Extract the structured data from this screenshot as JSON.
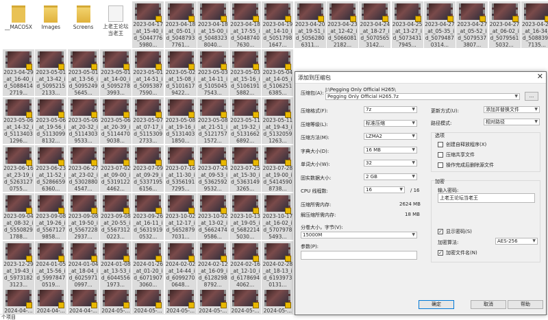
{
  "explorer": {
    "status": "个项目",
    "rows": [
      [
        {
          "label": "__MACOSX",
          "type": "folder"
        },
        {
          "label": "Images",
          "type": "folder-img"
        },
        {
          "label": "Screens",
          "type": "folder-img"
        },
        {
          "label": "上老王论坛当老王",
          "type": "file"
        },
        {
          "label": "2023-04-17_at_15-40_id_50447765980...",
          "type": "video"
        },
        {
          "label": "2023-04-18_at_05-01_id_50487937761...",
          "type": "video"
        },
        {
          "label": "2023-04-18_at_15-00_id_50483238040...",
          "type": "video"
        },
        {
          "label": "2023-04-18_at_17-55_id_50487407630...",
          "type": "video"
        },
        {
          "label": "2023-04-19_at_14-10_id_50517981647...",
          "type": "video"
        },
        {
          "label": "2023-04-20_at_19-51_id_50562806311...",
          "type": "video"
        },
        {
          "label": "2023-04-23_at_12-42_id_50660812182...",
          "type": "video"
        },
        {
          "label": "2023-04-24_at_18-27_id_50705653142...",
          "type": "video"
        },
        {
          "label": "2023-04-25_at_13-27_id_50734317945...",
          "type": "video"
        },
        {
          "label": "2023-04-27_at_05-35_id_50794870314...",
          "type": "video"
        },
        {
          "label": "2023-04-27_at_05-52_id_50795373807...",
          "type": "video"
        },
        {
          "label": "2023-04-27_at_06-02_id_50795615032...",
          "type": "video"
        },
        {
          "label": "2023-04-29_at_16-34_id_50883997135...",
          "type": "video"
        }
      ],
      [
        {
          "label": "2023-04-29_at_16-40_id_50884142719..."
        },
        {
          "label": "2023-05-01_at_13-42_id_50952152133..."
        },
        {
          "label": "2023-05-01_at_13-56_id_50952495645..."
        },
        {
          "label": "2023-05-01_at_14-00_id_50952783993..."
        },
        {
          "label": "2023-05-01_at_14-51_id_50953877590..."
        },
        {
          "label": "2023-05-02_at_15-08_id_51016179422..."
        },
        {
          "label": "2023-05-03_at_14-11_id_51050457543..."
        },
        {
          "label": "2023-05-03_at_15-16_id_51061915882..."
        },
        {
          "label": "2023-05-04_at_14-05_id_51062516385..."
        }
      ],
      [
        {
          "label": "2023-05-06_at_14-32_id_51134031296..."
        },
        {
          "label": "2023-05-06_at_19-56_id_51130998132..."
        },
        {
          "label": "2023-05-06_at_20-32_id_51143039533..."
        },
        {
          "label": "2023-05-06_at_20-39_id_51144709038..."
        },
        {
          "label": "2023-05-07_at_07-17_id_51153092733..."
        },
        {
          "label": "2023-05-08_at_19-16_id_51314031850..."
        },
        {
          "label": "2023-05-08_at_21-51_id_51217571572..."
        },
        {
          "label": "2023-05-11_at_19-32_id_51316626892..."
        },
        {
          "label": "2023-05-11_at_19-43_id_51320591263..."
        }
      ],
      [
        {
          "label": "2023-06-16_at_23-19_id_52631270755..."
        },
        {
          "label": "2023-06-23_at_11-52_id_52866596360..."
        },
        {
          "label": "2023-06-27_at_23-02_id_53028804547..."
        },
        {
          "label": "2023-07-02_at_09-00_id_53191224462..."
        },
        {
          "label": "2023-07-09_at_09-29_id_53371956156..."
        },
        {
          "label": "2023-07-16_at_11-30_id_53561917295..."
        },
        {
          "label": "2023-07-24_at_09-53_id_53625929532..."
        },
        {
          "label": "2023-07-25_at_15-30_id_53631493265..."
        },
        {
          "label": "2023-07-28_at_19-00_id_54145908738..."
        }
      ],
      [
        {
          "label": "2023-09-04_at_08-32_id_55508291788..."
        },
        {
          "label": "2023-09-08_at_19-26_id_55671279858..."
        },
        {
          "label": "2023-09-08_at_19-50_id_55672282937..."
        },
        {
          "label": "2023-09-08_at_20-55_id_55673120223..."
        },
        {
          "label": "2023-09-26_at_16-11_id_56319190532..."
        },
        {
          "label": "2023-10-02_at_12-17_id_56528797031..."
        },
        {
          "label": "2023-10-02_at_13-02_id_56624749586..."
        },
        {
          "label": "2023-10-13_at_19-05_id_56822145030..."
        },
        {
          "label": "2023-10-17_at_16-02_id_57079785493..."
        }
      ],
      [
        {
          "label": "2023-12-29_at_19-43_id_59731823123..."
        },
        {
          "label": "2024-01-05_at_15-56_id_59978470519..."
        },
        {
          "label": "2024-01-04_at_18-04_id_60259710997..."
        },
        {
          "label": "2024-01-08_at_13-53_id_60445561973..."
        },
        {
          "label": "2024-01-26_at_01-20_id_60719073060..."
        },
        {
          "label": "2024-02-02_at_14-44_id_60992700648..."
        },
        {
          "label": "2024-02-12_at_16-09_id_61282988792..."
        },
        {
          "label": "2024-02-16_at_12-10_id_61786944062..."
        },
        {
          "label": "2024-02-28_at_18-13_id_61939730131..."
        }
      ],
      [
        {
          "label": "2024-04-..."
        },
        {
          "label": "2024-04-..."
        },
        {
          "label": "2024-04-..."
        },
        {
          "label": "2024-05-..."
        },
        {
          "label": "2024-05-..."
        },
        {
          "label": "2024-05-..."
        },
        {
          "label": "2024-05-..."
        },
        {
          "label": "2024-05-..."
        },
        {
          "label": "2024-05-..."
        }
      ]
    ]
  },
  "dialog": {
    "title": "添加到压缩包",
    "close": "✕",
    "archive_label": "压缩包(A):",
    "archive_path": "J:\\Pegging Only Official H265\\",
    "archive_name": "Pegging Only Official H265.7z",
    "browse_label": "...",
    "fields": [
      {
        "label": "压缩格式(F):",
        "value": "7z"
      },
      {
        "label": "压缩等级(L):",
        "value": "标准压缩"
      },
      {
        "label": "压缩方法(M):",
        "value": "LZMA2"
      },
      {
        "label": "字典大小(D):",
        "value": "16 MB"
      },
      {
        "label": "单词大小(W):",
        "value": "32"
      },
      {
        "label": "固实数据大小:",
        "value": "2 GB"
      },
      {
        "label": "CPU 线程数:",
        "value": "16"
      }
    ],
    "cpu_total": "/ 16",
    "mem_compress_label": "压缩所需内存:",
    "mem_compress_value": "2624 MB",
    "mem_decompress_label": "解压缩所需内存:",
    "mem_decompress_value": "18 MB",
    "split_label": "分卷大小，字节(V):",
    "split_value": "15000M",
    "params_label": "参数(P):",
    "params_value": "",
    "update_label": "更新方式(U):",
    "update_value": "添加并替换文件",
    "path_label": "路径模式:",
    "path_value": "相对路径",
    "options_label": "选项",
    "opt_sfx": "创建自释放程序(X)",
    "opt_shared": "压缩共享文件",
    "opt_delete": "操作完成后删除源文件",
    "encrypt_label": "加密",
    "password_label": "输入密码:",
    "password_value": "上老王论坛当老王",
    "show_password": "显示密码(S)",
    "enc_method_label": "加密算法:",
    "enc_method_value": "AES-256",
    "encrypt_names": "加密文件名(N)",
    "ok": "确定",
    "cancel": "取消",
    "help": "帮助",
    "check": "✓"
  }
}
